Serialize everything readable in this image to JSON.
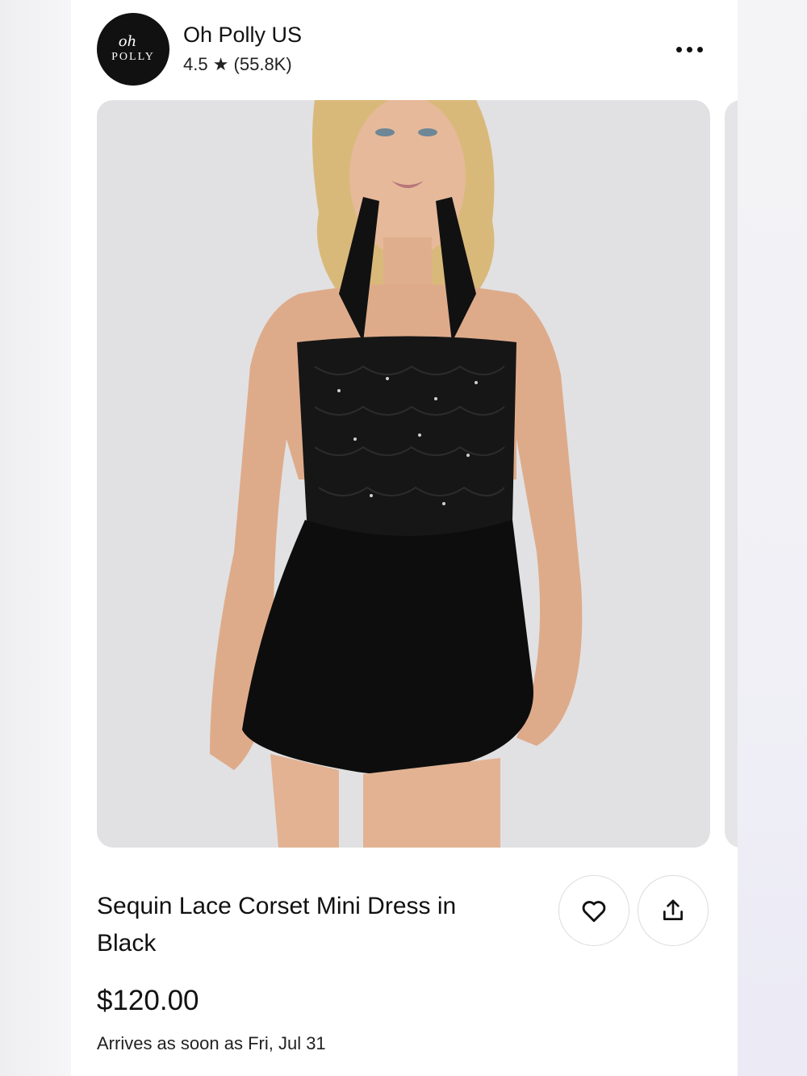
{
  "store": {
    "name": "Oh Polly US",
    "rating_text": "4.5 ★ (55.8K)",
    "logo_script": "oh",
    "logo_word": "POLLY"
  },
  "product": {
    "title": "Sequin Lace Corset Mini Dress in Black",
    "price": "$120.00",
    "delivery": "Arrives as soon as Fri, Jul 31",
    "image_icon": "product-photo"
  },
  "icons": {
    "more": "more-icon",
    "favorite": "heart-icon",
    "share": "share-icon"
  },
  "colors": {
    "logo_bg": "#111111",
    "photo_bg": "#e1e1e3",
    "dress": "#0d0d0d"
  }
}
